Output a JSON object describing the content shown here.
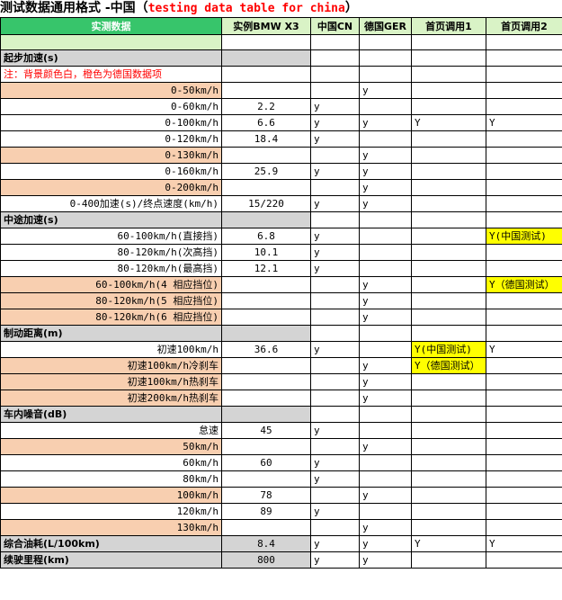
{
  "title": {
    "main": "测试数据通用格式 -中国（",
    "en": "testing data table for china",
    "close": "）"
  },
  "header": [
    "实测数据",
    "实例BMW X3",
    "中国CN",
    "德国GER",
    "首页调用1",
    "首页调用2"
  ],
  "rows": [
    {
      "type": "green",
      "cells": [
        "",
        "",
        "",
        "",
        "",
        ""
      ]
    },
    {
      "type": "section",
      "cells": [
        "起步加速(s)",
        "",
        "",
        "",
        "",
        ""
      ]
    },
    {
      "type": "note",
      "cells": [
        "注：背景颜色白，橙色为德国数据项",
        "",
        "",
        "",
        "",
        ""
      ]
    },
    {
      "type": "peach",
      "cells": [
        "0-50km/h",
        "",
        "",
        "y",
        "",
        ""
      ]
    },
    {
      "type": "white",
      "cells": [
        "0-60km/h",
        "2.2",
        "y",
        "",
        "",
        ""
      ]
    },
    {
      "type": "white",
      "cells": [
        "0-100km/h",
        "6.6",
        "y",
        "y",
        "Y",
        "Y"
      ]
    },
    {
      "type": "white",
      "cells": [
        "0-120km/h",
        "18.4",
        "y",
        "",
        "",
        ""
      ]
    },
    {
      "type": "peach",
      "cells": [
        "0-130km/h",
        "",
        "",
        "y",
        "",
        ""
      ]
    },
    {
      "type": "white",
      "cells": [
        "0-160km/h",
        "25.9",
        "y",
        "y",
        "",
        ""
      ]
    },
    {
      "type": "peach",
      "cells": [
        "0-200km/h",
        "",
        "",
        "y",
        "",
        ""
      ]
    },
    {
      "type": "white",
      "cells": [
        "0-400加速(s)/终点速度(km/h)",
        "15/220",
        "y",
        "y",
        "",
        ""
      ]
    },
    {
      "type": "section",
      "cells": [
        "中途加速(s)",
        "",
        "",
        "",
        "",
        ""
      ]
    },
    {
      "type": "white",
      "cells": [
        "60-100km/h(直接挡)",
        "6.8",
        "y",
        "",
        "",
        "Y(中国测试)"
      ],
      "yellow": [
        5
      ]
    },
    {
      "type": "white",
      "cells": [
        "80-120km/h(次高挡)",
        "10.1",
        "y",
        "",
        "",
        ""
      ]
    },
    {
      "type": "white",
      "cells": [
        "80-120km/h(最高挡)",
        "12.1",
        "y",
        "",
        "",
        ""
      ]
    },
    {
      "type": "peach",
      "cells": [
        "60-100km/h(4 相应挡位)",
        "",
        "",
        "y",
        "",
        "Y（德国测试）"
      ],
      "yellow": [
        5
      ]
    },
    {
      "type": "peach",
      "cells": [
        "80-120km/h(5 相应挡位)",
        "",
        "",
        "y",
        "",
        ""
      ]
    },
    {
      "type": "peach",
      "cells": [
        "80-120km/h(6 相应挡位)",
        "",
        "",
        "y",
        "",
        ""
      ]
    },
    {
      "type": "section",
      "cells": [
        "制动距离(m)",
        "",
        "",
        "",
        "",
        ""
      ]
    },
    {
      "type": "white",
      "cells": [
        "初速100km/h",
        "36.6",
        "y",
        "",
        "Y(中国测试)",
        "Y"
      ],
      "yellow": [
        4
      ]
    },
    {
      "type": "peach",
      "cells": [
        "初速100km/h冷刹车",
        "",
        "",
        "y",
        "Y（德国测试）",
        ""
      ],
      "yellow": [
        4
      ]
    },
    {
      "type": "peach",
      "cells": [
        "初速100km/h热刹车",
        "",
        "",
        "y",
        "",
        ""
      ]
    },
    {
      "type": "peach",
      "cells": [
        "初速200km/h热刹车",
        "",
        "",
        "y",
        "",
        ""
      ]
    },
    {
      "type": "section",
      "cells": [
        "车内噪音(dB)",
        "",
        "",
        "",
        "",
        ""
      ]
    },
    {
      "type": "white",
      "cells": [
        "怠速",
        "45",
        "y",
        "",
        "",
        ""
      ]
    },
    {
      "type": "peach",
      "cells": [
        "50km/h",
        "",
        "",
        "y",
        "",
        ""
      ]
    },
    {
      "type": "white",
      "cells": [
        "60km/h",
        "60",
        "y",
        "",
        "",
        ""
      ]
    },
    {
      "type": "white",
      "cells": [
        "80km/h",
        "",
        "y",
        "",
        "",
        ""
      ]
    },
    {
      "type": "peach",
      "cells": [
        "100km/h",
        "78",
        "",
        "y",
        "",
        ""
      ]
    },
    {
      "type": "white",
      "cells": [
        "120km/h",
        "89",
        "y",
        "",
        "",
        ""
      ]
    },
    {
      "type": "peach",
      "cells": [
        "130km/h",
        "",
        "",
        "y",
        "",
        ""
      ]
    },
    {
      "type": "section",
      "cells": [
        "综合油耗(L/100km)",
        "8.4",
        "y",
        "y",
        "Y",
        "Y"
      ]
    },
    {
      "type": "section",
      "cells": [
        "续驶里程(km)",
        "800",
        "y",
        "y",
        "",
        ""
      ]
    }
  ]
}
